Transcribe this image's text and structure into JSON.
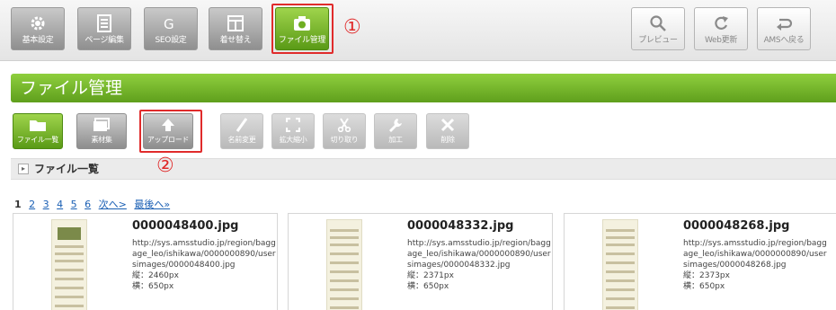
{
  "toolbar": {
    "buttons": [
      {
        "label": "基本設定",
        "icon": "gear-icon"
      },
      {
        "label": "ページ編集",
        "icon": "page-edit-icon"
      },
      {
        "label": "SEO設定",
        "icon": "seo-icon"
      },
      {
        "label": "着せ替え",
        "icon": "layout-icon"
      },
      {
        "label": "ファイル管理",
        "icon": "camera-icon"
      }
    ],
    "right_buttons": [
      {
        "label": "プレビュー",
        "icon": "search-icon"
      },
      {
        "label": "Web更新",
        "icon": "refresh-icon"
      },
      {
        "label": "AMSへ戻る",
        "icon": "return-icon"
      }
    ]
  },
  "annotations": {
    "one": "①",
    "two": "②"
  },
  "page_title": "ファイル管理",
  "subtoolbar": {
    "buttons": [
      {
        "label": "ファイル一覧",
        "icon": "folder-icon"
      },
      {
        "label": "素材集",
        "icon": "materials-icon"
      },
      {
        "label": "アップロード",
        "icon": "upload-icon"
      },
      {
        "label": "名前変更",
        "icon": "rename-icon"
      },
      {
        "label": "拡大縮小",
        "icon": "resize-icon"
      },
      {
        "label": "切り取り",
        "icon": "scissors-icon"
      },
      {
        "label": "加工",
        "icon": "wrench-icon"
      },
      {
        "label": "削除",
        "icon": "delete-icon"
      }
    ]
  },
  "section_title": "ファイル一覧",
  "pagination": {
    "current": "1",
    "pages": [
      "2",
      "3",
      "4",
      "5",
      "6"
    ],
    "next": "次へ>",
    "last": "最後へ»"
  },
  "files": [
    {
      "name": "0000048400.jpg",
      "url": "http://sys.amsstudio.jp/region/baggage_leo/ishikawa/0000000890/usersimages/0000048400.jpg",
      "height": "縦：2460px",
      "width": "横：650px"
    },
    {
      "name": "0000048332.jpg",
      "url": "http://sys.amsstudio.jp/region/baggage_leo/ishikawa/0000000890/usersimages/0000048332.jpg",
      "height": "縦：2371px",
      "width": "横：650px"
    },
    {
      "name": "0000048268.jpg",
      "url": "http://sys.amsstudio.jp/region/baggage_leo/ishikawa/0000000890/usersimages/0000048268.jpg",
      "height": "縦：2373px",
      "width": "横：650px"
    }
  ]
}
